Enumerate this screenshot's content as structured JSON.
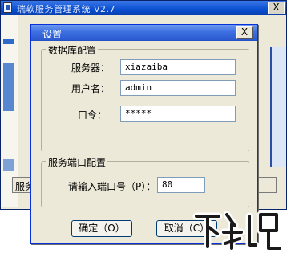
{
  "background_window": {
    "title": "瑞软服务管理系统 V2.7",
    "close_glyph": "X",
    "status_text": "服务"
  },
  "dialog": {
    "title": "设置",
    "close_glyph": "X",
    "db_group": {
      "label": "数据库配置",
      "server_label": "服务器：",
      "server_value": "xiazaiba",
      "user_label": "用户名：",
      "user_value": "admin",
      "password_label": "口令：",
      "password_value": "*****"
    },
    "port_group": {
      "label": "服务端口配置",
      "port_label": "请输入端口号（P）：",
      "port_value": "80"
    },
    "ok_label": "确定（O）",
    "cancel_label": "取消（C）"
  },
  "watermark": {
    "text": "下载吧"
  },
  "colors": {
    "titlebar": "#2c59d0",
    "dialog_bg": "#ece9d8",
    "field_border": "#7f9db9"
  },
  "icons": [
    "app-icon",
    "close-icon"
  ]
}
